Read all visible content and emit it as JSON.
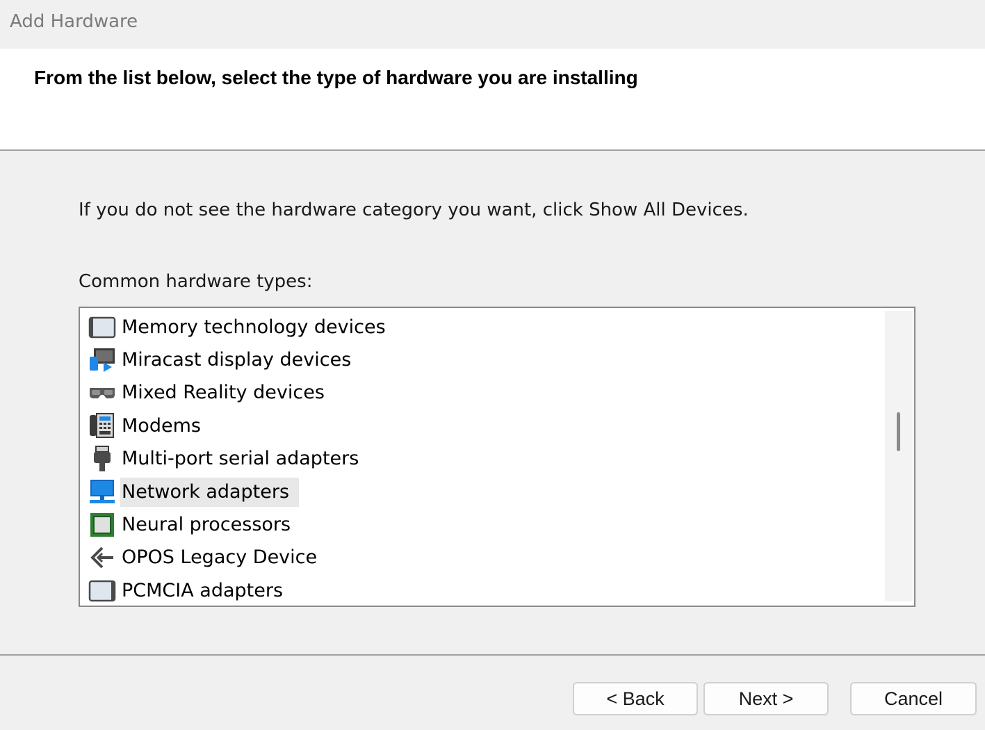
{
  "window": {
    "title": "Add Hardware"
  },
  "header": {
    "heading": "From the list below, select the type of hardware you are installing"
  },
  "body": {
    "info_text": "If you do not see the hardware category you want, click Show All Devices.",
    "list_label": "Common hardware types:"
  },
  "hardware_list": {
    "selected_item": "Network adapters",
    "items": [
      {
        "label": "Memory technology devices",
        "icon": "memory-card-icon"
      },
      {
        "label": "Miracast display devices",
        "icon": "miracast-display-icon"
      },
      {
        "label": "Mixed Reality devices",
        "icon": "headset-icon"
      },
      {
        "label": "Modems",
        "icon": "modem-icon"
      },
      {
        "label": "Multi-port serial adapters",
        "icon": "serial-port-icon"
      },
      {
        "label": "Network adapters",
        "icon": "network-adapter-icon"
      },
      {
        "label": "Neural processors",
        "icon": "chip-icon"
      },
      {
        "label": "OPOS Legacy Device",
        "icon": "opos-device-icon"
      },
      {
        "label": "PCMCIA adapters",
        "icon": "pcmcia-card-icon"
      }
    ]
  },
  "buttons": {
    "back": "< Back",
    "next": "Next >",
    "cancel": "Cancel"
  },
  "colors": {
    "window_bg": "#f0f0f0",
    "header_bg": "#ffffff",
    "selection_bg": "#e8e8e8",
    "network_blue": "#1e88e5"
  }
}
